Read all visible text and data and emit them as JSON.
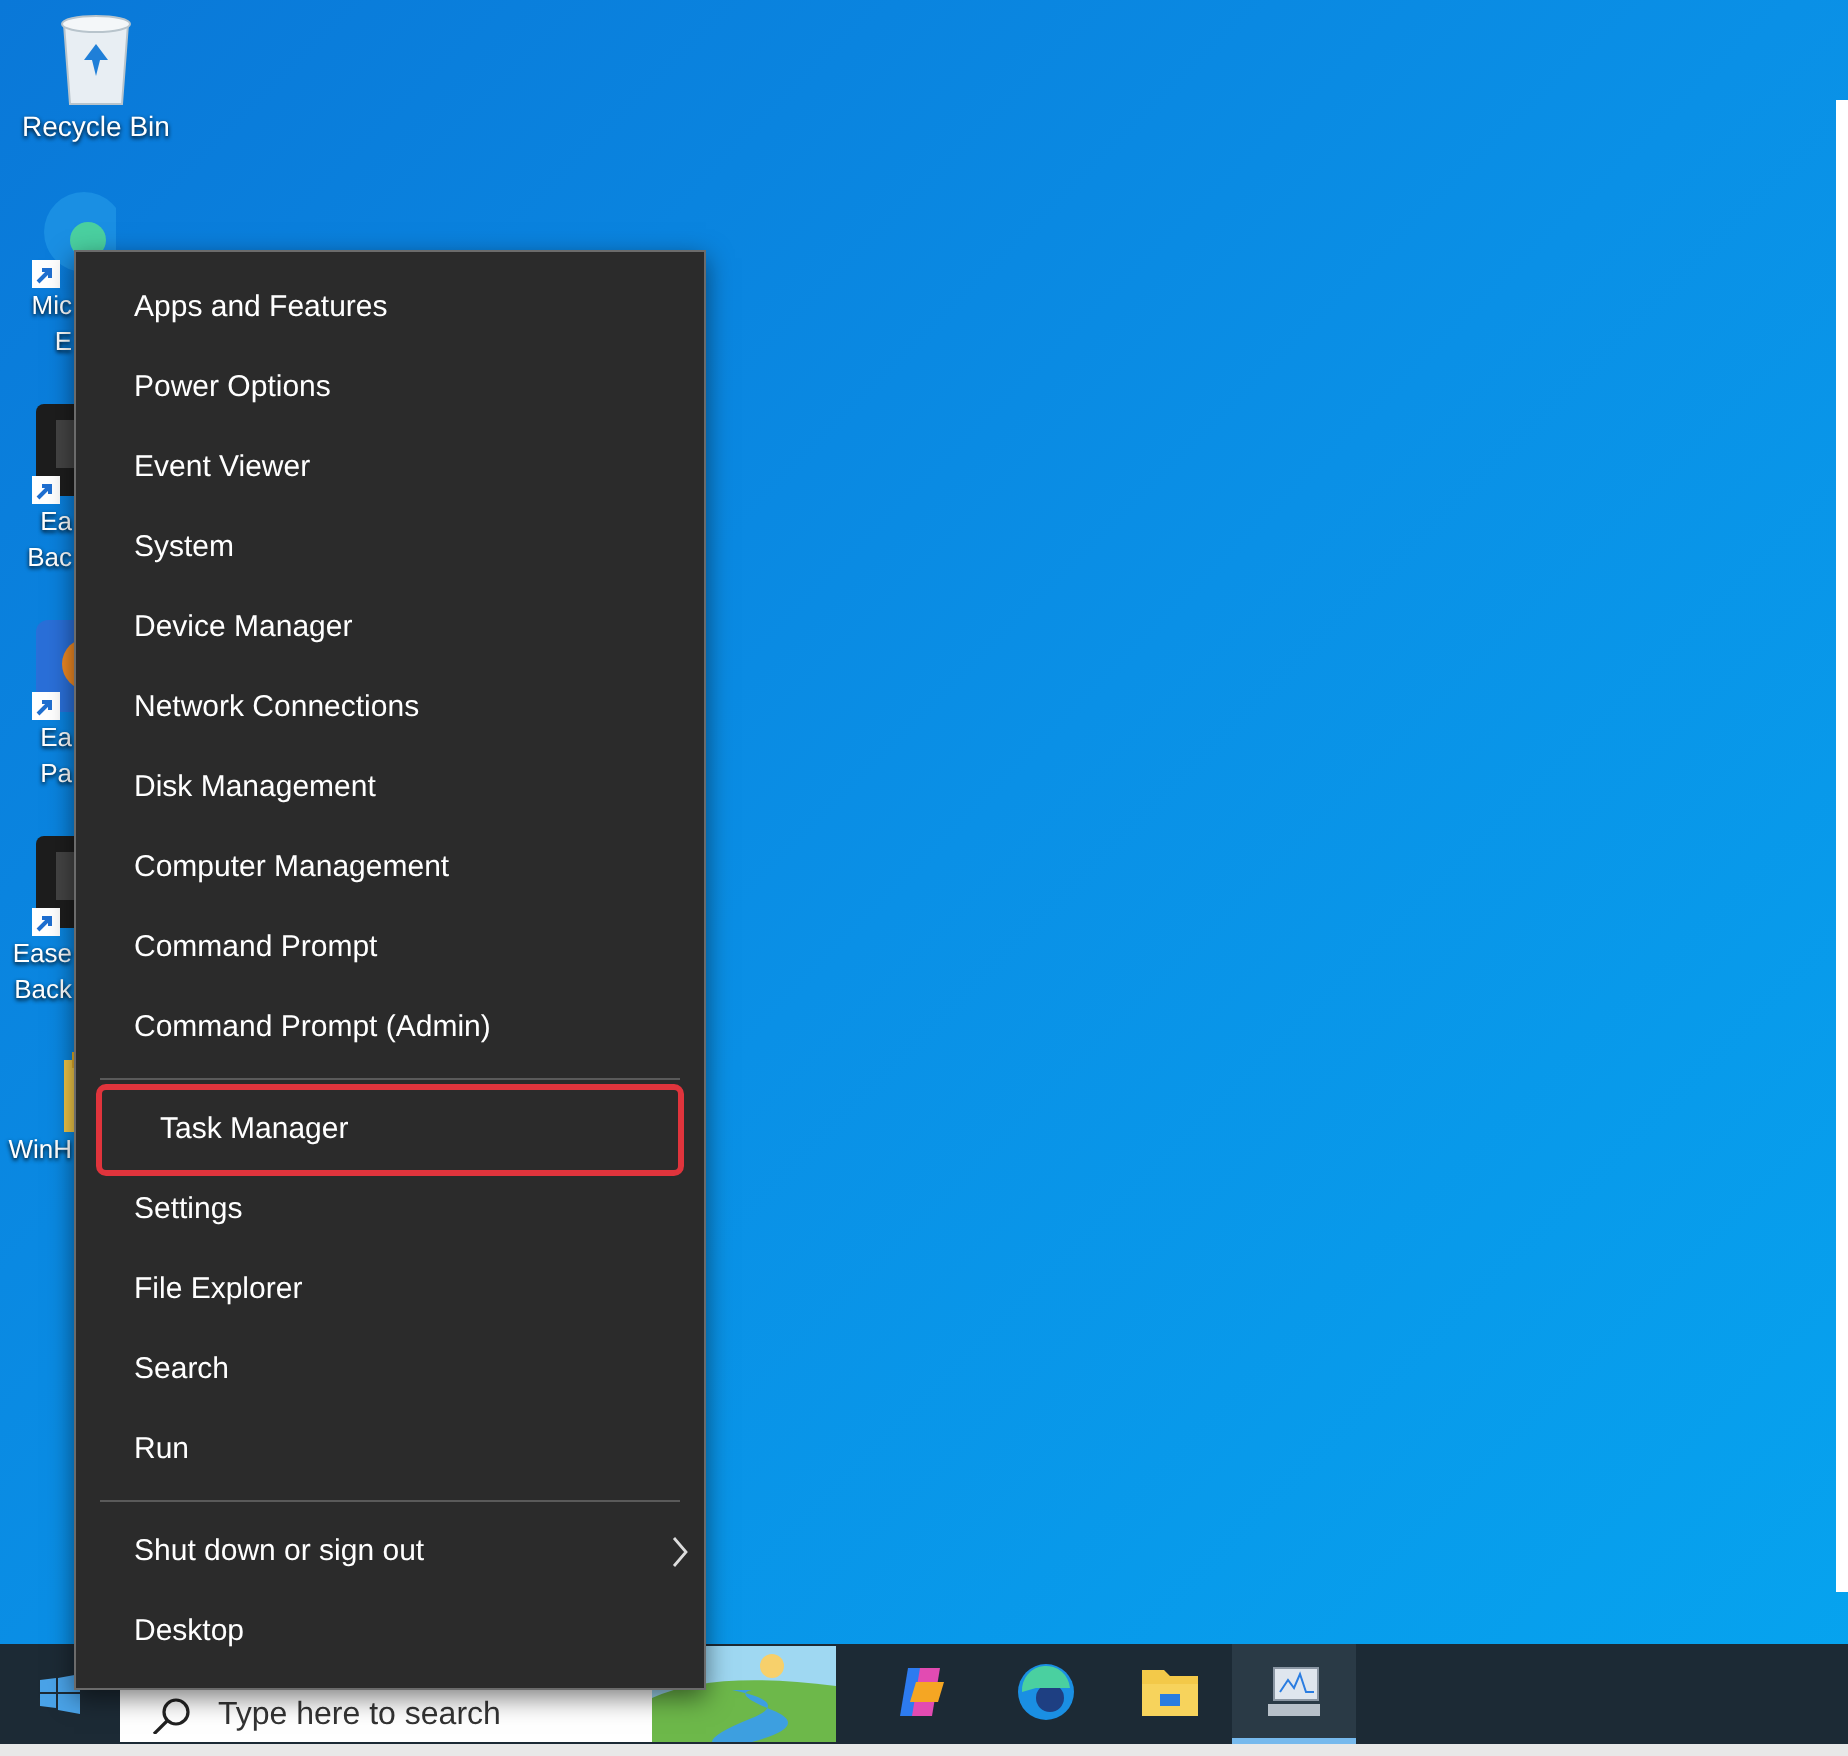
{
  "desktop_icons": [
    {
      "kind": "recycle",
      "label": [
        "Recycle Bin"
      ]
    },
    {
      "kind": "edge",
      "label": [
        "Mic",
        "E"
      ]
    },
    {
      "kind": "dark",
      "label": [
        "Ea",
        "Bac"
      ]
    },
    {
      "kind": "orange",
      "label": [
        "Ea",
        "Pa"
      ]
    },
    {
      "kind": "dark",
      "label": [
        "Ease",
        "Back"
      ]
    },
    {
      "kind": "folder",
      "label": [
        "WinH"
      ]
    }
  ],
  "menu": {
    "groups": [
      [
        {
          "label": "Apps and Features",
          "highlighted": false
        },
        {
          "label": "Power Options",
          "highlighted": false
        },
        {
          "label": "Event Viewer",
          "highlighted": false
        },
        {
          "label": "System",
          "highlighted": false
        },
        {
          "label": "Device Manager",
          "highlighted": false
        },
        {
          "label": "Network Connections",
          "highlighted": false
        },
        {
          "label": "Disk Management",
          "highlighted": false
        },
        {
          "label": "Computer Management",
          "highlighted": false
        },
        {
          "label": "Command Prompt",
          "highlighted": false
        },
        {
          "label": "Command Prompt (Admin)",
          "highlighted": false
        }
      ],
      [
        {
          "label": "Task Manager",
          "highlighted": true
        },
        {
          "label": "Settings",
          "highlighted": false
        },
        {
          "label": "File Explorer",
          "highlighted": false
        },
        {
          "label": "Search",
          "highlighted": false
        },
        {
          "label": "Run",
          "highlighted": false
        }
      ],
      [
        {
          "label": "Shut down or sign out",
          "highlighted": false,
          "submenu": true
        },
        {
          "label": "Desktop",
          "highlighted": false
        }
      ]
    ]
  },
  "taskbar": {
    "search": {
      "placeholder": "Type here to search"
    },
    "apps": [
      {
        "kind": "copilot",
        "selected": false
      },
      {
        "kind": "edge",
        "selected": false
      },
      {
        "kind": "explorer",
        "selected": false
      },
      {
        "kind": "monitor",
        "selected": true
      }
    ]
  }
}
